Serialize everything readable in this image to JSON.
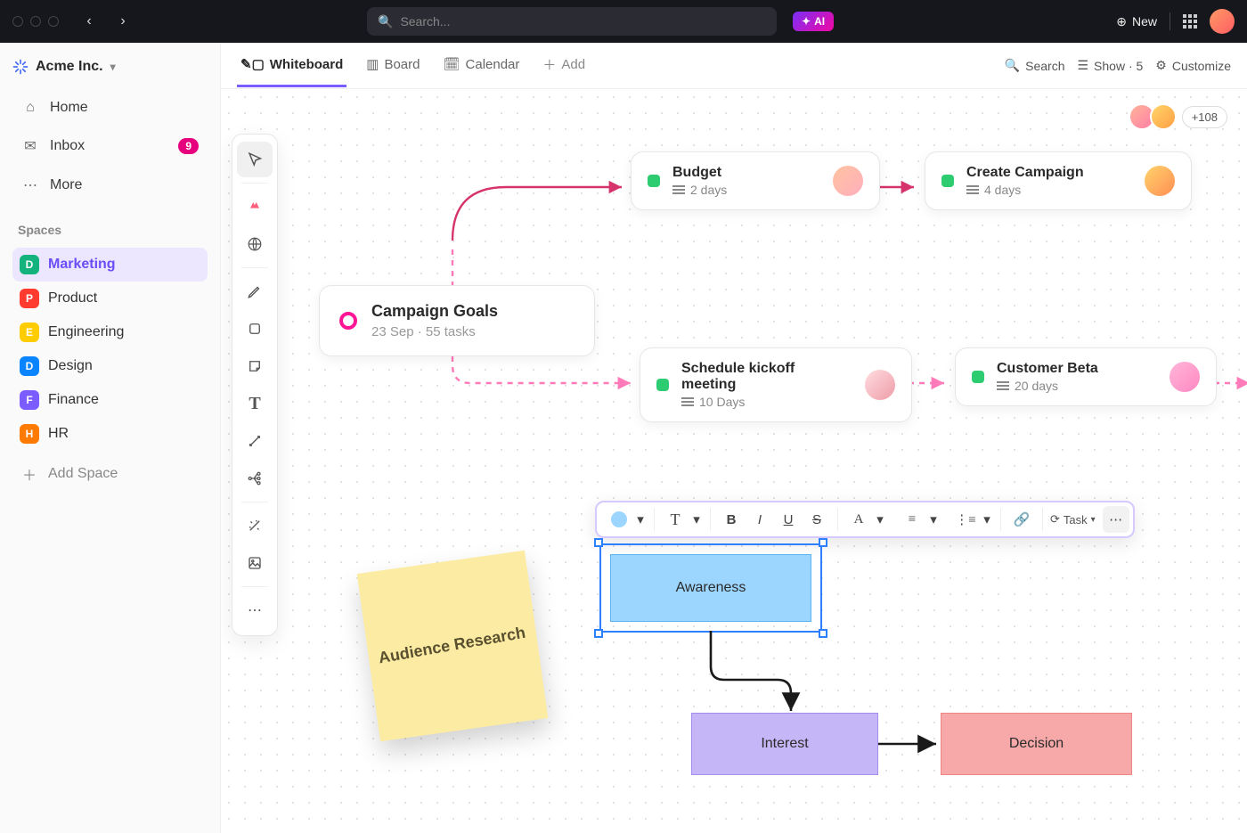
{
  "topbar": {
    "search_placeholder": "Search...",
    "ai_label": "AI",
    "new_label": "New"
  },
  "workspace": {
    "name": "Acme Inc."
  },
  "nav": {
    "home": "Home",
    "inbox": "Inbox",
    "inbox_count": "9",
    "more": "More",
    "spaces_label": "Spaces",
    "add_space": "Add Space",
    "spaces": [
      {
        "letter": "D",
        "label": "Marketing",
        "color": "#14b37d",
        "active": true
      },
      {
        "letter": "P",
        "label": "Product",
        "color": "#ff3b30"
      },
      {
        "letter": "E",
        "label": "Engineering",
        "color": "#ffcc00"
      },
      {
        "letter": "D",
        "label": "Design",
        "color": "#0a84ff"
      },
      {
        "letter": "F",
        "label": "Finance",
        "color": "#7b5cff"
      },
      {
        "letter": "H",
        "label": "HR",
        "color": "#ff7a00"
      }
    ]
  },
  "views": {
    "tabs": [
      {
        "key": "whiteboard",
        "label": "Whiteboard",
        "active": true
      },
      {
        "key": "board",
        "label": "Board"
      },
      {
        "key": "calendar",
        "label": "Calendar"
      }
    ],
    "add": "Add",
    "search": "Search",
    "show": "Show · 5",
    "customize": "Customize"
  },
  "presence": {
    "overflow": "+108"
  },
  "cards": {
    "goal": {
      "title": "Campaign Goals",
      "meta": "23 Sep  ·  55 tasks"
    },
    "budget": {
      "title": "Budget",
      "meta": "2 days"
    },
    "create": {
      "title": "Create Campaign",
      "meta": "4 days"
    },
    "kickoff": {
      "title": "Schedule kickoff meeting",
      "meta": "10 Days"
    },
    "beta": {
      "title": "Customer Beta",
      "meta": "20 days"
    }
  },
  "sticky": {
    "text": "Audience Research"
  },
  "flow": {
    "awareness": "Awareness",
    "interest": "Interest",
    "decision": "Decision"
  },
  "floating_toolbar": {
    "task_label": "Task"
  }
}
